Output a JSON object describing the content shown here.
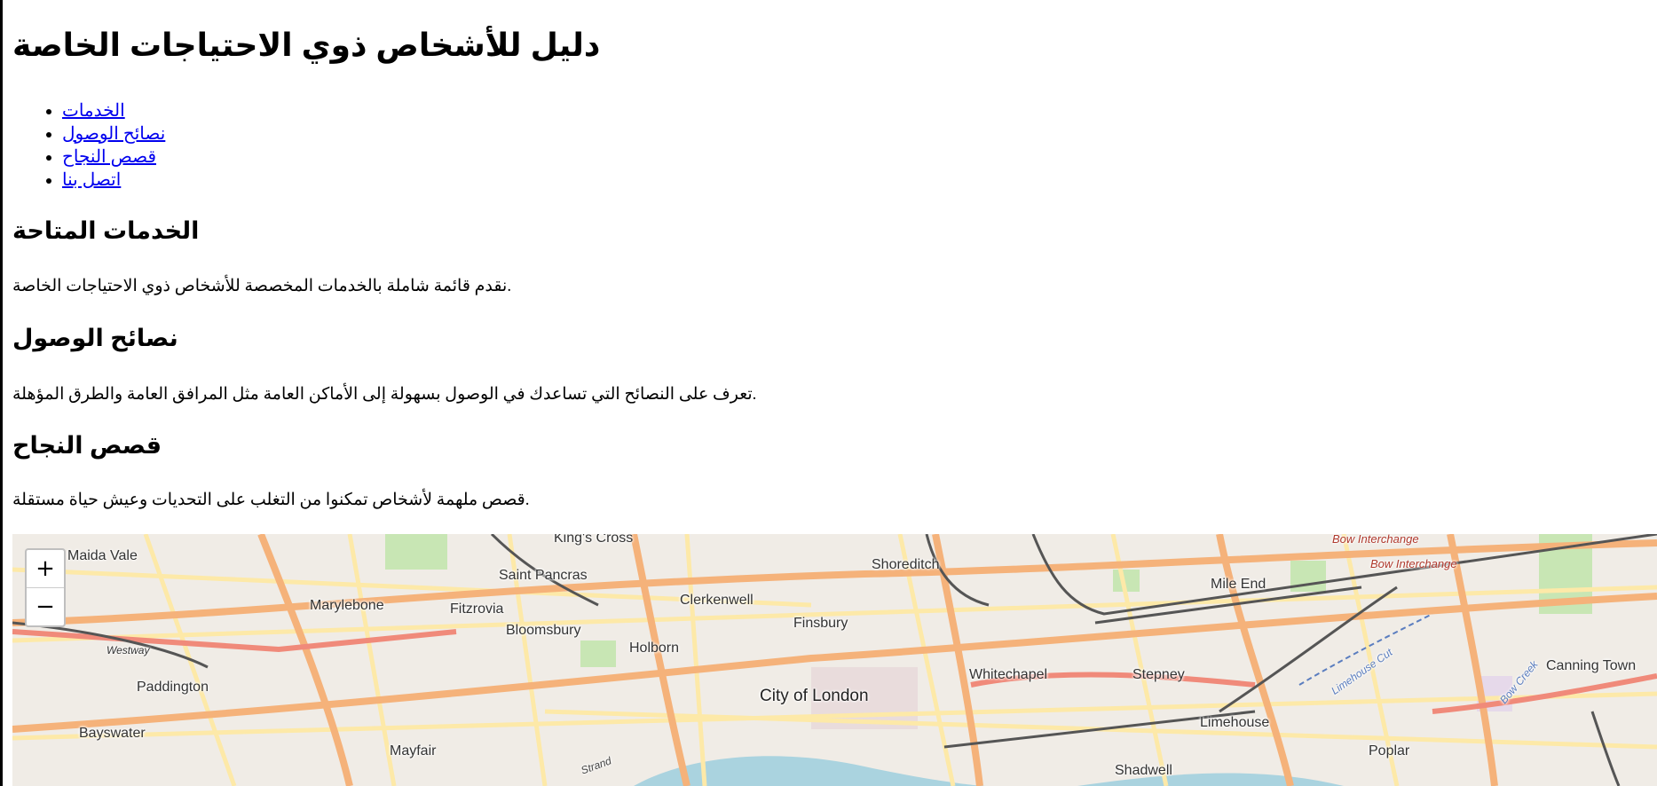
{
  "page": {
    "title": "دليل للأشخاص ذوي الاحتياجات الخاصة"
  },
  "nav": {
    "items": [
      {
        "label": "الخدمات"
      },
      {
        "label": "نصائح الوصول"
      },
      {
        "label": "قصص النجاح"
      },
      {
        "label": "اتصل بنا"
      }
    ]
  },
  "sections": {
    "services": {
      "heading": "الخدمات المتاحة",
      "text": "نقدم قائمة شاملة بالخدمات المخصصة للأشخاص ذوي الاحتياجات الخاصة."
    },
    "access": {
      "heading": "نصائح الوصول",
      "text": "تعرف على النصائح التي تساعدك في الوصول بسهولة إلى الأماكن العامة مثل المرافق العامة والطرق المؤهلة."
    },
    "stories": {
      "heading": "قصص النجاح",
      "text": "قصص ملهمة لأشخاص تمكنوا من التغلب على التحديات وعيش حياة مستقلة."
    }
  },
  "map": {
    "zoom_in": "+",
    "zoom_out": "−",
    "labels": {
      "maida_vale": "Maida Vale",
      "kings_cross": "King's Cross",
      "saint_pancras": "Saint Pancras",
      "shoreditch": "Shoreditch",
      "bow_interchange_1": "Bow Interchange",
      "bow_interchange_2": "Bow Interchange",
      "mile_end": "Mile End",
      "marylebone": "Marylebone",
      "fitzrovia": "Fitzrovia",
      "clerkenwell": "Clerkenwell",
      "bloomsbury": "Bloomsbury",
      "finsbury": "Finsbury",
      "westway": "Westway",
      "holborn": "Holborn",
      "whitechapel": "Whitechapel",
      "stepney": "Stepney",
      "canning_town": "Canning Town",
      "paddington": "Paddington",
      "city_of_london": "City of London",
      "limehouse": "Limehouse",
      "bayswater": "Bayswater",
      "mayfair": "Mayfair",
      "poplar": "Poplar",
      "shadwell": "Shadwell",
      "strand": "Strand",
      "limehouse_cut": "Limehouse Cut",
      "bow_creek": "Bow Creek"
    }
  },
  "colors": {
    "link": "#0000ee",
    "map_bg": "#f0ece6",
    "road_major": "#f5b27a",
    "road_minor": "#fde9a8",
    "park": "#c8e6b4",
    "water": "#aad3df",
    "rail": "#555555"
  }
}
